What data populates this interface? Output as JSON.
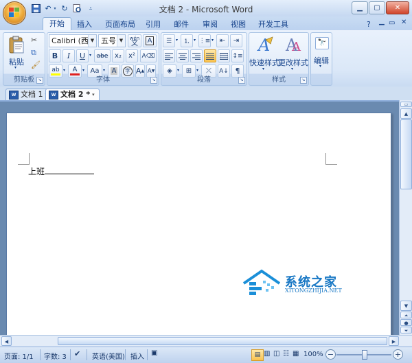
{
  "window": {
    "title": "文档 2 - Microsoft Word",
    "qat": [
      "save-icon",
      "undo-icon",
      "redo-icon",
      "print-preview-icon",
      "customize-icon"
    ],
    "controls": [
      "minimize-icon",
      "maximize-icon",
      "close-icon"
    ]
  },
  "ribbon_tabs": [
    "开始",
    "插入",
    "页面布局",
    "引用",
    "邮件",
    "审阅",
    "视图",
    "开发工具"
  ],
  "ribbon_tab_active": "开始",
  "clipboard": {
    "paste_label": "粘贴",
    "group_label": "剪贴板"
  },
  "font": {
    "name_value": "Calibri (西文正",
    "size_value": "五号",
    "phonetic": "wén",
    "border_char": "A",
    "bold": "B",
    "italic": "I",
    "underline": "U",
    "strike": "abe",
    "subscript": "x₂",
    "superscript": "x²",
    "highlight": "ab",
    "font_color": "A",
    "change_case": "Aa",
    "shading_char": "A",
    "enclose_char": "字",
    "grow": "A",
    "shrink": "A",
    "group_label": "字体"
  },
  "paragraph": {
    "group_label": "段落"
  },
  "styles": {
    "quick_label": "快速样式",
    "change_label": "更改样式",
    "group_label": "样式"
  },
  "editing": {
    "label": "编辑"
  },
  "doc_tabs": [
    {
      "label": "文档 1",
      "active": false
    },
    {
      "label": "文档 2",
      "active": true
    }
  ],
  "document": {
    "text": "上班"
  },
  "status": {
    "page": "页面: 1/1",
    "words": "字数: 3",
    "language": "英语(美国)",
    "mode": "插入",
    "zoom": "100%"
  },
  "watermark": {
    "title": "系统之家",
    "url": "XITONGZHIJIA.NET"
  },
  "colors": {
    "accent": "#15428b",
    "highlight": "#f9c24e",
    "font_color_bar": "#e02020",
    "highlight_bar": "#ffff00"
  }
}
